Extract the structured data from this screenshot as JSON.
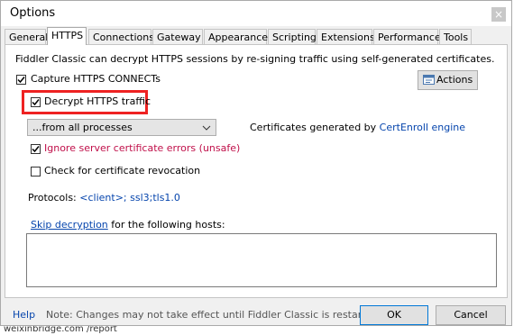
{
  "window": {
    "title": "Options",
    "close_glyph": "×"
  },
  "tabs": [
    {
      "label": "General"
    },
    {
      "label": "HTTPS",
      "active": true
    },
    {
      "label": "Connections"
    },
    {
      "label": "Gateway"
    },
    {
      "label": "Appearance"
    },
    {
      "label": "Scripting"
    },
    {
      "label": "Extensions"
    },
    {
      "label": "Performance"
    },
    {
      "label": "Tools"
    }
  ],
  "https": {
    "description": "Fiddler Classic can decrypt HTTPS sessions by re-signing traffic using self-generated certificates.",
    "capture_label": "Capture HTTPS CONNECTs",
    "capture_checked": true,
    "decrypt_label": "Decrypt HTTPS traffic",
    "decrypt_checked": true,
    "actions_label": "Actions",
    "process_filter": "...from all processes",
    "cert_prefix": "Certificates generated by",
    "cert_engine": "CertEnroll engine",
    "ignore_errors_label": "Ignore server certificate errors (unsafe)",
    "ignore_errors_checked": true,
    "revocation_label": "Check for certificate revocation",
    "revocation_checked": false,
    "protocols_label": "Protocols:",
    "protocols_value": "<client>; ssl3;tls1.0",
    "skip_link": "Skip decryption",
    "skip_suffix": "for the following hosts:",
    "hosts_value": ""
  },
  "footer": {
    "help": "Help",
    "note": "Note: Changes may not take effect until Fiddler Classic is restarted.",
    "ok": "OK",
    "cancel": "Cancel"
  },
  "background": {
    "text": "weixinbridge.com     /report"
  },
  "colors": {
    "highlight": "#ee2222",
    "link": "#0645ad",
    "warning_text": "#c0104a"
  },
  "icons": {
    "actions": "actions-icon",
    "checkmark": "checkmark-icon",
    "dropdown": "chevron-down-icon"
  }
}
